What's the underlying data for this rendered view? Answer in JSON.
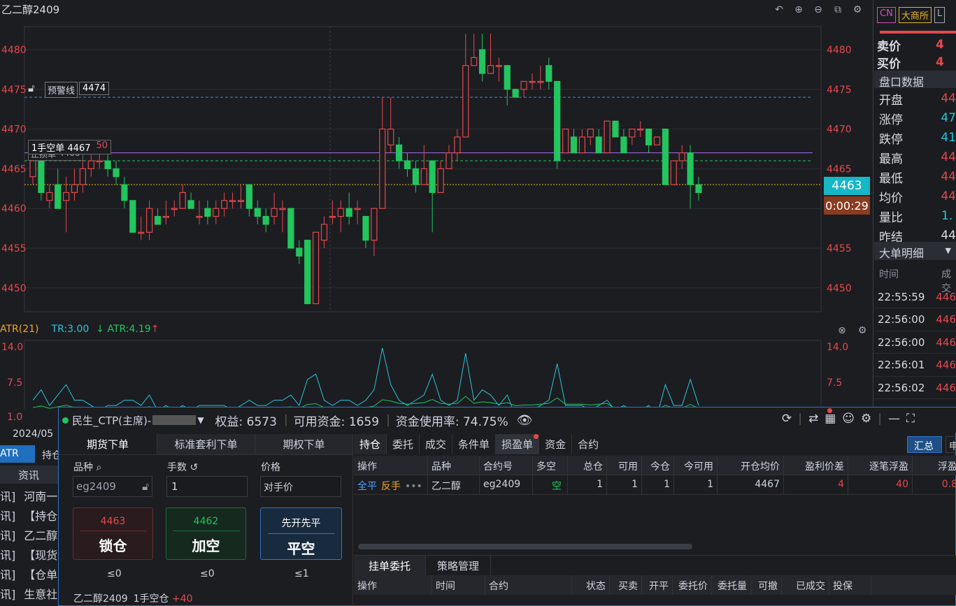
{
  "chart": {
    "title": "乙二醇2409",
    "price_labels": [
      "4480",
      "4475",
      "4470",
      "4465",
      "4460",
      "4455",
      "4450"
    ],
    "warn_line_label": "预警线",
    "warn_line_value": "4474",
    "order_label": "1手空单 4467",
    "order_qty": "50",
    "stop_label": "止损单",
    "stop_value": "4466",
    "current_price": "4463",
    "countdown": "0:00:29",
    "date_label": "2024/05",
    "candles": [
      {
        "o": 4464,
        "c": 4466,
        "h": 4467,
        "l": 4463
      },
      {
        "o": 4466,
        "c": 4462,
        "h": 4467,
        "l": 4461
      },
      {
        "o": 4461,
        "c": 4462,
        "h": 4463,
        "l": 4460
      },
      {
        "o": 4463,
        "c": 4460,
        "h": 4465,
        "l": 4460
      },
      {
        "o": 4461,
        "c": 4462,
        "h": 4464,
        "l": 4457
      },
      {
        "o": 4462,
        "c": 4463,
        "h": 4465,
        "l": 4461
      },
      {
        "o": 4463,
        "c": 4465,
        "h": 4466,
        "l": 4462
      },
      {
        "o": 4465,
        "c": 4466,
        "h": 4467,
        "l": 4464
      },
      {
        "o": 4466,
        "c": 4466,
        "h": 4467,
        "l": 4465
      },
      {
        "o": 4466,
        "c": 4465,
        "h": 4467,
        "l": 4464
      },
      {
        "o": 4465,
        "c": 4464,
        "h": 4466,
        "l": 4463
      },
      {
        "o": 4463,
        "c": 4461,
        "h": 4464,
        "l": 4460
      },
      {
        "o": 4461,
        "c": 4457,
        "h": 4461,
        "l": 4457
      },
      {
        "o": 4457,
        "c": 4457,
        "h": 4459,
        "l": 4456
      },
      {
        "o": 4457,
        "c": 4460,
        "h": 4461,
        "l": 4456
      },
      {
        "o": 4459,
        "c": 4458,
        "h": 4460,
        "l": 4458
      },
      {
        "o": 4459,
        "c": 4459,
        "h": 4461,
        "l": 4458
      },
      {
        "o": 4460,
        "c": 4460,
        "h": 4461,
        "l": 4459
      },
      {
        "o": 4460,
        "c": 4462,
        "h": 4463,
        "l": 4460
      },
      {
        "o": 4461,
        "c": 4460,
        "h": 4462,
        "l": 4460
      },
      {
        "o": 4459,
        "c": 4459,
        "h": 4461,
        "l": 4458
      },
      {
        "o": 4460,
        "c": 4459,
        "h": 4461,
        "l": 4458
      },
      {
        "o": 4459,
        "c": 4460,
        "h": 4461,
        "l": 4458
      },
      {
        "o": 4460,
        "c": 4461,
        "h": 4462,
        "l": 4459
      },
      {
        "o": 4461,
        "c": 4461,
        "h": 4462,
        "l": 4460
      },
      {
        "o": 4461,
        "c": 4461,
        "h": 4463,
        "l": 4460
      },
      {
        "o": 4463,
        "c": 4460,
        "h": 4463,
        "l": 4459
      },
      {
        "o": 4460,
        "c": 4459,
        "h": 4461,
        "l": 4458
      },
      {
        "o": 4459,
        "c": 4458,
        "h": 4460,
        "l": 4457
      },
      {
        "o": 4459,
        "c": 4460,
        "h": 4462,
        "l": 4458
      },
      {
        "o": 4460,
        "c": 4460,
        "h": 4461,
        "l": 4457
      },
      {
        "o": 4460,
        "c": 4455,
        "h": 4460,
        "l": 4455
      },
      {
        "o": 4455,
        "c": 4454,
        "h": 4456,
        "l": 4453
      },
      {
        "o": 4456,
        "c": 4448,
        "h": 4456,
        "l": 4448
      },
      {
        "o": 4448,
        "c": 4457,
        "h": 4457,
        "l": 4448
      },
      {
        "o": 4456,
        "c": 4458,
        "h": 4459,
        "l": 4455
      },
      {
        "o": 4459,
        "c": 4459,
        "h": 4461,
        "l": 4458
      },
      {
        "o": 4459,
        "c": 4460,
        "h": 4461,
        "l": 4457
      },
      {
        "o": 4460,
        "c": 4459,
        "h": 4462,
        "l": 4458
      },
      {
        "o": 4460,
        "c": 4460,
        "h": 4461,
        "l": 4458
      },
      {
        "o": 4459,
        "c": 4456,
        "h": 4459,
        "l": 4455
      },
      {
        "o": 4456,
        "c": 4460,
        "h": 4460,
        "l": 4454
      },
      {
        "o": 4460,
        "c": 4470,
        "h": 4474,
        "l": 4460
      },
      {
        "o": 4468,
        "c": 4470,
        "h": 4474,
        "l": 4467
      },
      {
        "o": 4468,
        "c": 4466,
        "h": 4469,
        "l": 4465
      },
      {
        "o": 4466,
        "c": 4465,
        "h": 4467,
        "l": 4464
      },
      {
        "o": 4465,
        "c": 4463,
        "h": 4466,
        "l": 4462
      },
      {
        "o": 4463,
        "c": 4465,
        "h": 4468,
        "l": 4463
      },
      {
        "o": 4466,
        "c": 4462,
        "h": 4466,
        "l": 4457
      },
      {
        "o": 4462,
        "c": 4465,
        "h": 4466,
        "l": 4462
      },
      {
        "o": 4465,
        "c": 4467,
        "h": 4468,
        "l": 4465
      },
      {
        "o": 4467,
        "c": 4469,
        "h": 4470,
        "l": 4466
      },
      {
        "o": 4469,
        "c": 4478,
        "h": 4482,
        "l": 4469
      },
      {
        "o": 4478,
        "c": 4479,
        "h": 4482,
        "l": 4478
      },
      {
        "o": 4480,
        "c": 4477,
        "h": 4482,
        "l": 4476
      },
      {
        "o": 4477,
        "c": 4478,
        "h": 4482,
        "l": 4477
      },
      {
        "o": 4478,
        "c": 4478,
        "h": 4479,
        "l": 4476
      },
      {
        "o": 4478,
        "c": 4475,
        "h": 4478,
        "l": 4473
      },
      {
        "o": 4475,
        "c": 4474,
        "h": 4475,
        "l": 4474
      },
      {
        "o": 4475,
        "c": 4476,
        "h": 4476,
        "l": 4474
      },
      {
        "o": 4476,
        "c": 4476,
        "h": 4477,
        "l": 4475
      },
      {
        "o": 4476,
        "c": 4476,
        "h": 4478,
        "l": 4475
      },
      {
        "o": 4478,
        "c": 4476,
        "h": 4479,
        "l": 4475
      },
      {
        "o": 4476,
        "c": 4466,
        "h": 4476,
        "l": 4465
      },
      {
        "o": 4467,
        "c": 4470,
        "h": 4470,
        "l": 4467
      },
      {
        "o": 4469,
        "c": 4467,
        "h": 4470,
        "l": 4467
      },
      {
        "o": 4467,
        "c": 4469,
        "h": 4470,
        "l": 4467
      },
      {
        "o": 4469,
        "c": 4470,
        "h": 4470,
        "l": 4468
      },
      {
        "o": 4469,
        "c": 4467,
        "h": 4470,
        "l": 4467
      },
      {
        "o": 4467,
        "c": 4471,
        "h": 4471,
        "l": 4467
      },
      {
        "o": 4471,
        "c": 4469,
        "h": 4471,
        "l": 4469
      },
      {
        "o": 4469,
        "c": 4467,
        "h": 4470,
        "l": 4467
      },
      {
        "o": 4469,
        "c": 4470,
        "h": 4470,
        "l": 4468
      },
      {
        "o": 4470,
        "c": 4470,
        "h": 4471,
        "l": 4469
      },
      {
        "o": 4470,
        "c": 4468,
        "h": 4470,
        "l": 4467
      },
      {
        "o": 4468,
        "c": 4469,
        "h": 4469,
        "l": 4468
      },
      {
        "o": 4470,
        "c": 4463,
        "h": 4470,
        "l": 4463
      },
      {
        "o": 4463,
        "c": 4466,
        "h": 4466,
        "l": 4463
      },
      {
        "o": 4466,
        "c": 4467,
        "h": 4468,
        "l": 4465
      },
      {
        "o": 4467,
        "c": 4463,
        "h": 4468,
        "l": 4460
      },
      {
        "o": 4463,
        "c": 4462,
        "h": 4464,
        "l": 4461
      }
    ],
    "atr_title": "ATR(21)",
    "atr_tr": "TR:3.00",
    "atr_value": "ATR:4.19",
    "atr_labels": [
      "14.0",
      "7.5",
      "1.0"
    ]
  },
  "side": {
    "tag_cn": "CN",
    "tag_exchange": "大商所",
    "tag_l": "L",
    "sell_label": "卖价",
    "sell_val": "4",
    "buy_label": "买价",
    "buy_val": "4",
    "panel_title": "盘口数据",
    "rows": [
      {
        "label": "开盘",
        "value": "44",
        "color": "#e5484d"
      },
      {
        "label": "涨停",
        "value": "47",
        "color": "#26c6da"
      },
      {
        "label": "跌停",
        "value": "41",
        "color": "#26c6da"
      },
      {
        "label": "最高",
        "value": "44",
        "color": "#e5484d"
      },
      {
        "label": "最低",
        "value": "44",
        "color": "#e5484d"
      },
      {
        "label": "均价",
        "value": "44",
        "color": "#e5484d"
      },
      {
        "label": "量比",
        "value": "1.",
        "color": "#26c6da"
      },
      {
        "label": "昨结",
        "value": "44",
        "color": "#d8dbe2"
      }
    ],
    "big_title": "大单明细",
    "col_time": "时间",
    "col_deal": "成交",
    "trades": [
      {
        "time": "22:55:59",
        "value": "446"
      },
      {
        "time": "22:56:00",
        "value": "446"
      },
      {
        "time": "22:56:00",
        "value": "446"
      },
      {
        "time": "22:56:01",
        "value": "446"
      },
      {
        "time": "22:56:02",
        "value": "446"
      }
    ]
  },
  "left": {
    "tab_atr": "ATR",
    "tab_hold": "持仓",
    "news_header": "资讯",
    "news": [
      {
        "tag": "讯]",
        "text": "河南一"
      },
      {
        "tag": "讯]",
        "text": "【持仓"
      },
      {
        "tag": "讯]",
        "text": "乙二醇"
      },
      {
        "tag": "讯]",
        "text": "【现货"
      },
      {
        "tag": "讯]",
        "text": "【仓单"
      },
      {
        "tag": "讯]",
        "text": "生意社"
      }
    ]
  },
  "trade": {
    "account": "民生_CTP(主席)-",
    "equity": "权益: 6573",
    "available": "可用资金: 1659",
    "usage": "资金使用率: 74.75%",
    "order_tabs": [
      "期货下单",
      "标准套利下单",
      "期权下单"
    ],
    "symbol_label": "品种",
    "qty_label": "手数",
    "price_label": "价格",
    "symbol_value": "eg2409",
    "qty_value": "1",
    "price_value": "对手价",
    "btn_lock_price": "4463",
    "btn_lock": "锁仓",
    "btn_short_price": "4462",
    "btn_short": "加空",
    "btn_close_top": "先开先平",
    "btn_close": "平空",
    "cnt1": "≤0",
    "cnt2": "≤0",
    "cnt3": "≤1",
    "status_sym": "乙二醇2409",
    "status_pos": "1手空仓",
    "status_pnl": "+40",
    "pos_tabs": [
      "持仓",
      "委托",
      "成交",
      "条件单",
      "损盈单",
      "资金",
      "合约"
    ],
    "summary_btn": "汇总",
    "extra_btn": "申",
    "pos_headers": [
      "操作",
      "品种",
      "合约号",
      "多空",
      "总仓",
      "可用",
      "今仓",
      "今可用",
      "开仓均价",
      "盈利价差",
      "逐笔浮盈",
      "浮盈"
    ],
    "pos_row": {
      "op1": "全平",
      "op2": "反手",
      "op3": "•••",
      "name": "乙二醇",
      "code": "eg2409",
      "dir": "空",
      "total": "1",
      "avail": "1",
      "today": "1",
      "today_avail": "1",
      "avg": "4467",
      "diff": "4",
      "pnl": "40",
      "float": "0.8"
    },
    "bottom_tabs": [
      "挂单委托",
      "策略管理"
    ],
    "bottom_headers": [
      "操作",
      "时间",
      "合约",
      "状态",
      "买卖",
      "开平",
      "委托价",
      "委托量",
      "可撤",
      "已成交",
      "投保"
    ]
  }
}
